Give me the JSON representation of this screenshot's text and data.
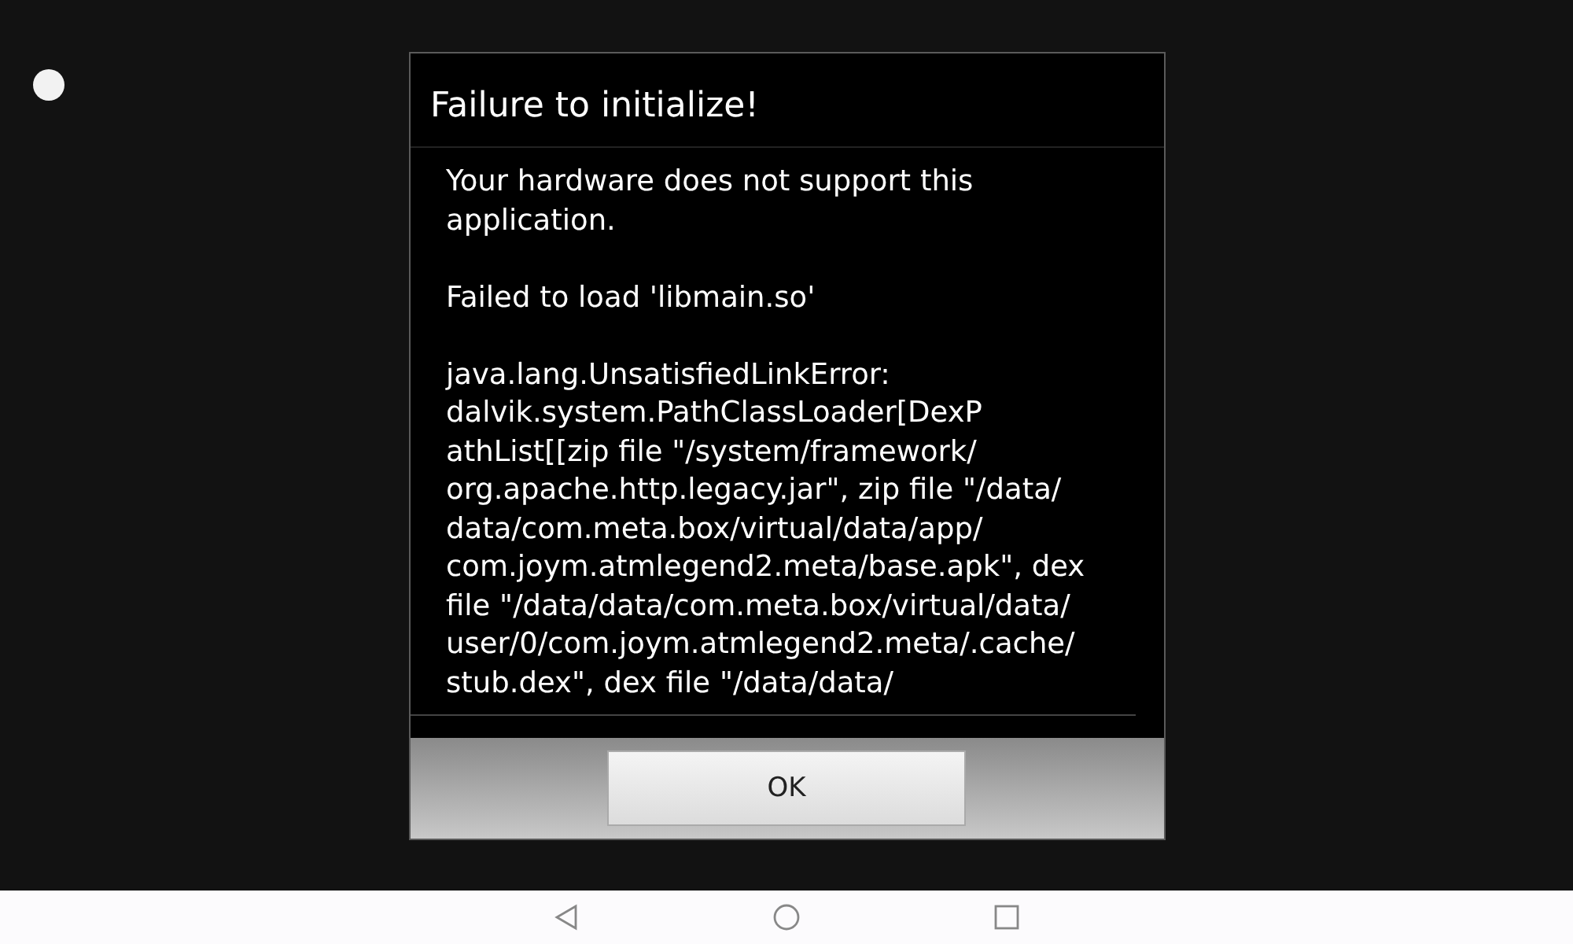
{
  "dialog": {
    "title": "Failure to initialize!",
    "paragraphs": [
      [
        "Your hardware does not support this",
        "application."
      ],
      [
        "Failed to load 'libmain.so'"
      ],
      [
        "java.lang.UnsatisfiedLinkError:",
        "dalvik.system.PathClassLoader[DexP",
        "athList[[zip file \"/system/framework/",
        "org.apache.http.legacy.jar\", zip file \"/data/",
        "data/com.meta.box/virtual/data/app/",
        "com.joym.atmlegend2.meta/base.apk\", dex",
        "file \"/data/data/com.meta.box/virtual/data/",
        "user/0/com.joym.atmlegend2.meta/.cache/",
        "stub.dex\", dex file \"/data/data/"
      ]
    ],
    "buttons": [
      {
        "label": "OK"
      }
    ]
  },
  "nav_bar": {
    "buttons": [
      {
        "kind": "back"
      },
      {
        "kind": "home"
      },
      {
        "kind": "recents"
      }
    ]
  }
}
